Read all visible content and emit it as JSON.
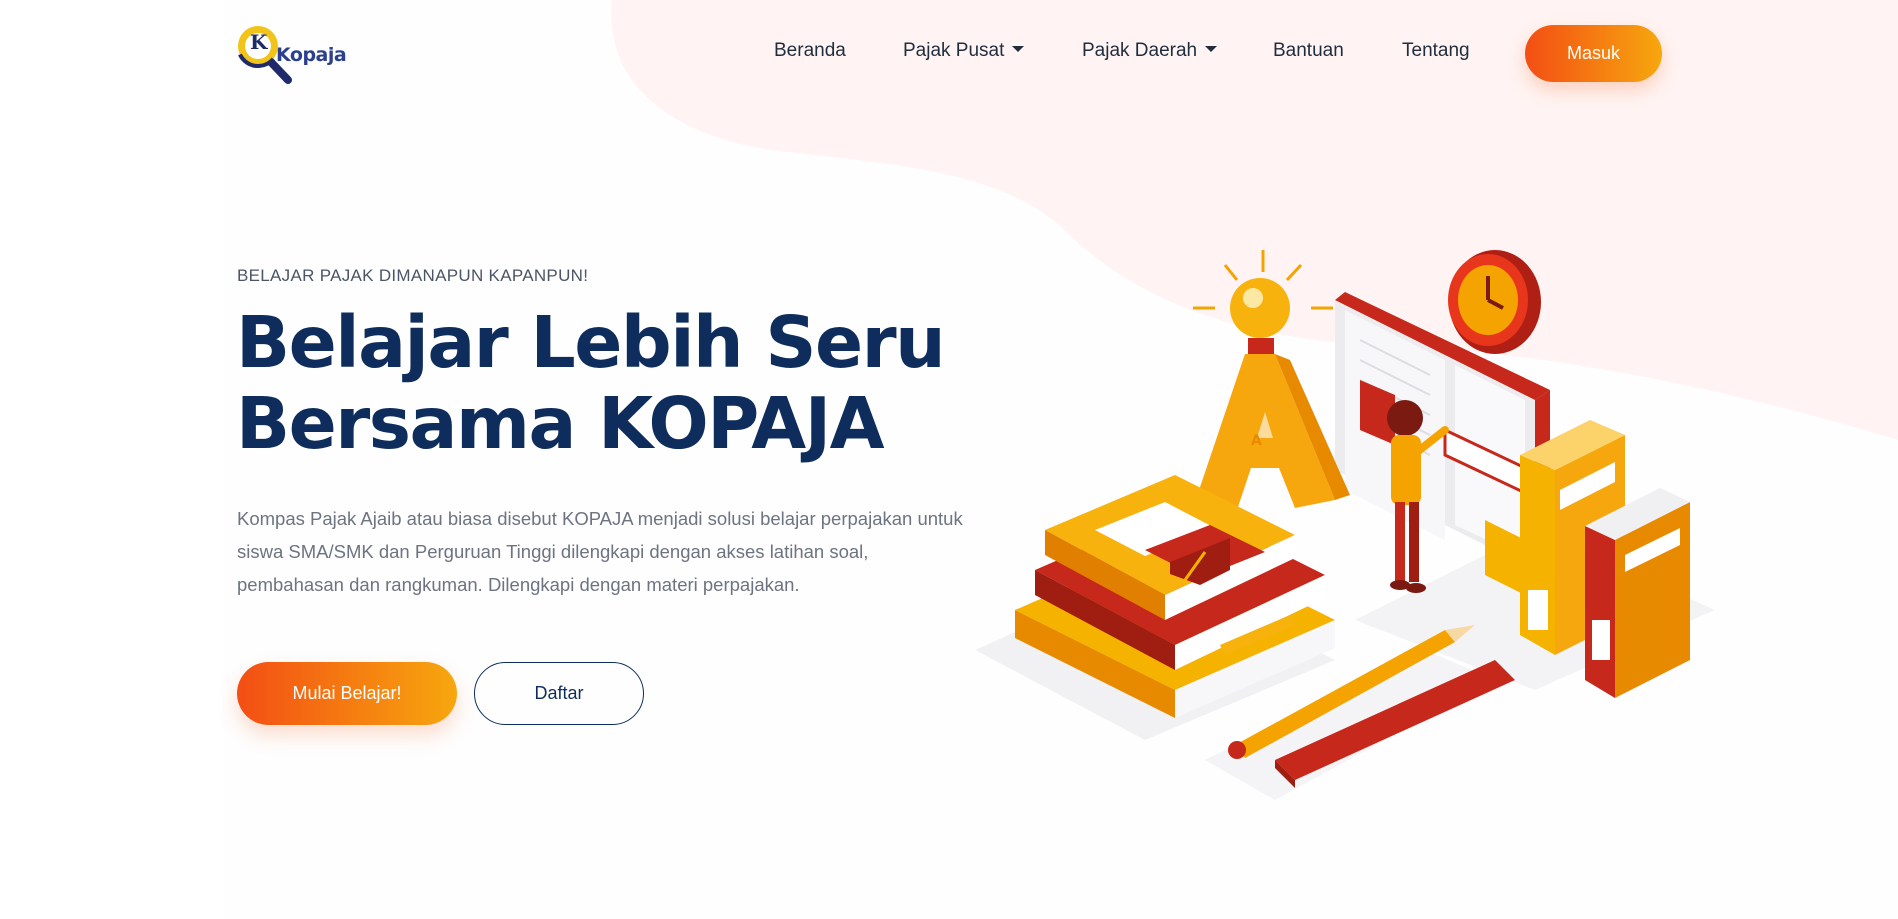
{
  "brand": {
    "name": "Kopaja",
    "mark_letter": "K"
  },
  "nav": {
    "items": [
      {
        "label": "Beranda"
      },
      {
        "label": "Pajak Pusat"
      },
      {
        "label": "Pajak Daerah"
      },
      {
        "label": "Bantuan"
      },
      {
        "label": "Tentang"
      }
    ],
    "login_label": "Masuk"
  },
  "hero": {
    "eyebrow": "BELAJAR PAJAK DIMANAPUN KAPANPUN!",
    "title_line1": "Belajar Lebih Seru",
    "title_line2": "Bersama KOPAJA",
    "description": "Kompas Pajak Ajaib atau biasa disebut KOPAJA menjadi solusi belajar perpajakan untuk siswa SMA/SMK dan Perguruan Tinggi dilengkapi dengan akses latihan soal, pembahasan dan rangkuman. Dilengkapi dengan materi perpajakan.",
    "primary_button": "Mulai Belajar!",
    "secondary_button": "Daftar",
    "illustration_letter": "A"
  },
  "colors": {
    "navy": "#0f2d5c",
    "orange_start": "#f34e14",
    "orange_end": "#f7a70e",
    "blob": "#fff4f3"
  }
}
